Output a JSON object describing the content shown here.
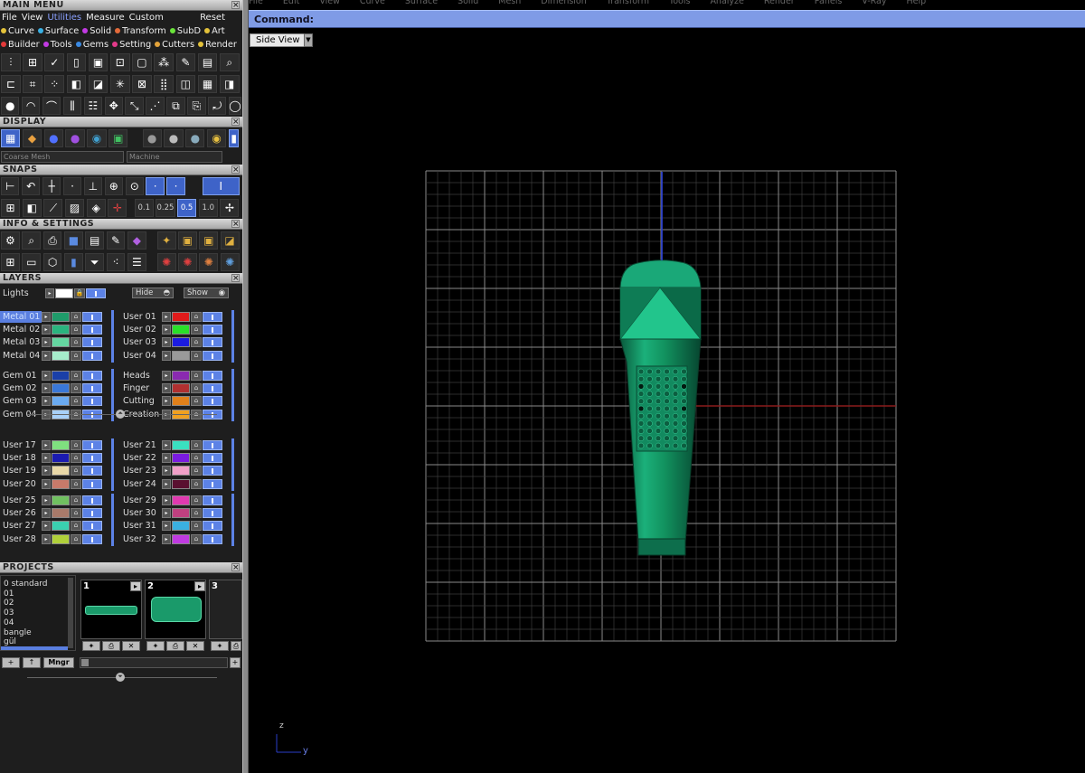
{
  "main_menu": {
    "header": "MAIN MENU",
    "items": [
      "File",
      "View",
      "Utilities",
      "Measure",
      "Custom"
    ],
    "reset": "Reset",
    "row1": [
      {
        "label": "Curve",
        "color": "#e3c23a"
      },
      {
        "label": "Surface",
        "color": "#3ab0e3"
      },
      {
        "label": "Solid",
        "color": "#c23ae3"
      },
      {
        "label": "Transform",
        "color": "#e36a3a"
      },
      {
        "label": "SubD",
        "color": "#6ae33a"
      },
      {
        "label": "Art",
        "color": "#e3c23a"
      }
    ],
    "row2": [
      {
        "label": "Builder",
        "color": "#e33a3a"
      },
      {
        "label": "Tools",
        "color": "#c23ae3"
      },
      {
        "label": "Gems",
        "color": "#3a8ae3"
      },
      {
        "label": "Setting",
        "color": "#e33a8a"
      },
      {
        "label": "Cutters",
        "color": "#e3a33a"
      },
      {
        "label": "Render",
        "color": "#e3c23a"
      }
    ]
  },
  "display": {
    "header": "DISPLAY",
    "mesh_select": "Coarse Mesh",
    "material_select": "Machine"
  },
  "snaps": {
    "header": "SNAPS",
    "values": [
      "0.1",
      "0.25",
      "0.5",
      "1.0"
    ]
  },
  "info_settings": {
    "header": "INFO & SETTINGS"
  },
  "layers": {
    "header": "LAYERS",
    "lights": "Lights",
    "hide": "Hide",
    "show": "Show",
    "groups": [
      {
        "left": [
          {
            "name": "Metal 01",
            "color": "#1f9b6a",
            "highlight": true
          },
          {
            "name": "Metal 02",
            "color": "#2ab47e"
          },
          {
            "name": "Metal 03",
            "color": "#64d6a0"
          },
          {
            "name": "Metal 04",
            "color": "#a6eccb"
          }
        ],
        "right": [
          {
            "name": "User 01",
            "color": "#e01b1b"
          },
          {
            "name": "User 02",
            "color": "#29e029"
          },
          {
            "name": "User 03",
            "color": "#1b1be0"
          },
          {
            "name": "User 04",
            "color": "#9a9a9a"
          }
        ]
      },
      {
        "left": [
          {
            "name": "Gem 01",
            "color": "#1a3fa8"
          },
          {
            "name": "Gem 02",
            "color": "#3a78d8"
          },
          {
            "name": "Gem 03",
            "color": "#6aaaf0"
          },
          {
            "name": "Gem 04",
            "color": "#a8d0f8"
          }
        ],
        "right": [
          {
            "name": "Heads",
            "color": "#8a2ab0"
          },
          {
            "name": "Finger",
            "color": "#b03030"
          },
          {
            "name": "Cutting",
            "color": "#e0801b"
          },
          {
            "name": "Creation",
            "color": "#f0a020"
          }
        ]
      },
      {
        "left": [
          {
            "name": "User 17",
            "color": "#7fe07f"
          },
          {
            "name": "User 18",
            "color": "#1b1bb0"
          },
          {
            "name": "User 19",
            "color": "#e8d8a8"
          },
          {
            "name": "User 20",
            "color": "#c87a6a"
          }
        ],
        "right": [
          {
            "name": "User 21",
            "color": "#3ae0c0"
          },
          {
            "name": "User 22",
            "color": "#7a1be0"
          },
          {
            "name": "User 23",
            "color": "#f0a0c8"
          },
          {
            "name": "User 24",
            "color": "#5a1030"
          }
        ]
      },
      {
        "left": [
          {
            "name": "User 25",
            "color": "#70c060"
          },
          {
            "name": "User 26",
            "color": "#a87a6a"
          },
          {
            "name": "User 27",
            "color": "#3ad0b0"
          },
          {
            "name": "User 28",
            "color": "#b0d03a"
          }
        ],
        "right": [
          {
            "name": "User 29",
            "color": "#e03ab0"
          },
          {
            "name": "User 30",
            "color": "#c04080"
          },
          {
            "name": "User 31",
            "color": "#3ab0e0"
          },
          {
            "name": "User 32",
            "color": "#c03ae0"
          }
        ]
      }
    ]
  },
  "projects": {
    "header": "PROJECTS",
    "list": [
      "0 standard",
      "01",
      "02",
      "03",
      "04",
      "bangle",
      "gül"
    ],
    "slots": [
      "1",
      "2",
      "3"
    ],
    "manager": "Mngr"
  },
  "viewport": {
    "menu": [
      "File",
      "Edit",
      "View",
      "Curve",
      "Surface",
      "Solid",
      "Mesh",
      "Dimension",
      "Transform",
      "Tools",
      "Analyze",
      "Render",
      "Panels",
      "V-Ray",
      "Help"
    ],
    "command_label": "Command:",
    "view_name": "Side View",
    "axis_vertical": "z",
    "axis_horizontal": "y",
    "model_color": "#14a070"
  }
}
